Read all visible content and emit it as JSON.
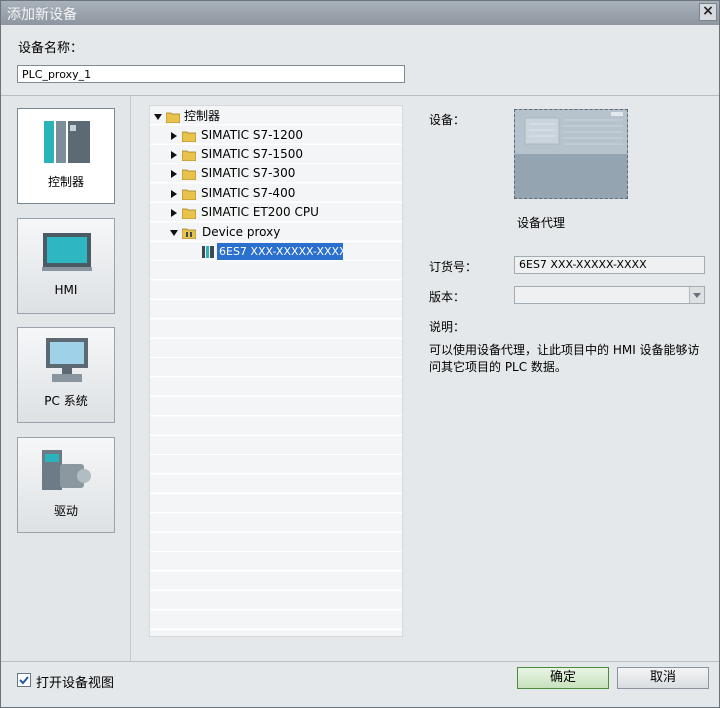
{
  "window": {
    "title": "添加新设备",
    "close_glyph": "×"
  },
  "device_name": {
    "label": "设备名称：",
    "value": "PLC_proxy_1"
  },
  "categories": [
    {
      "label": "控制器",
      "icon": "controller-icon"
    },
    {
      "label": "HMI",
      "icon": "hmi-icon"
    },
    {
      "label": "PC 系统",
      "icon": "pc-system-icon"
    },
    {
      "label": "驱动",
      "icon": "drive-icon"
    }
  ],
  "tree": {
    "root": "控制器",
    "items": [
      "SIMATIC S7-1200",
      "SIMATIC S7-1500",
      "SIMATIC S7-300",
      "SIMATIC S7-400",
      "SIMATIC ET200 CPU"
    ],
    "device_proxy": "Device proxy",
    "selected": "6ES7 XXX-XXXXX-XXXX"
  },
  "info": {
    "device_label": "设备：",
    "device_name": "设备代理",
    "order_label": "订货号：",
    "order_value": "6ES7 XXX-XXXXX-XXXX",
    "version_label": "版本：",
    "version_value": "",
    "desc_label": "说明：",
    "desc_text": "可以使用设备代理，让此项目中的 HMI 设备能够访问其它项目的 PLC 数据。"
  },
  "footer": {
    "open_view_label": "打开设备视图",
    "open_view_checked": true,
    "ok_label": "确定",
    "cancel_label": "取消"
  },
  "colors": {
    "selection": "#2b6fcf",
    "title_bar": "#9aa3ab"
  }
}
